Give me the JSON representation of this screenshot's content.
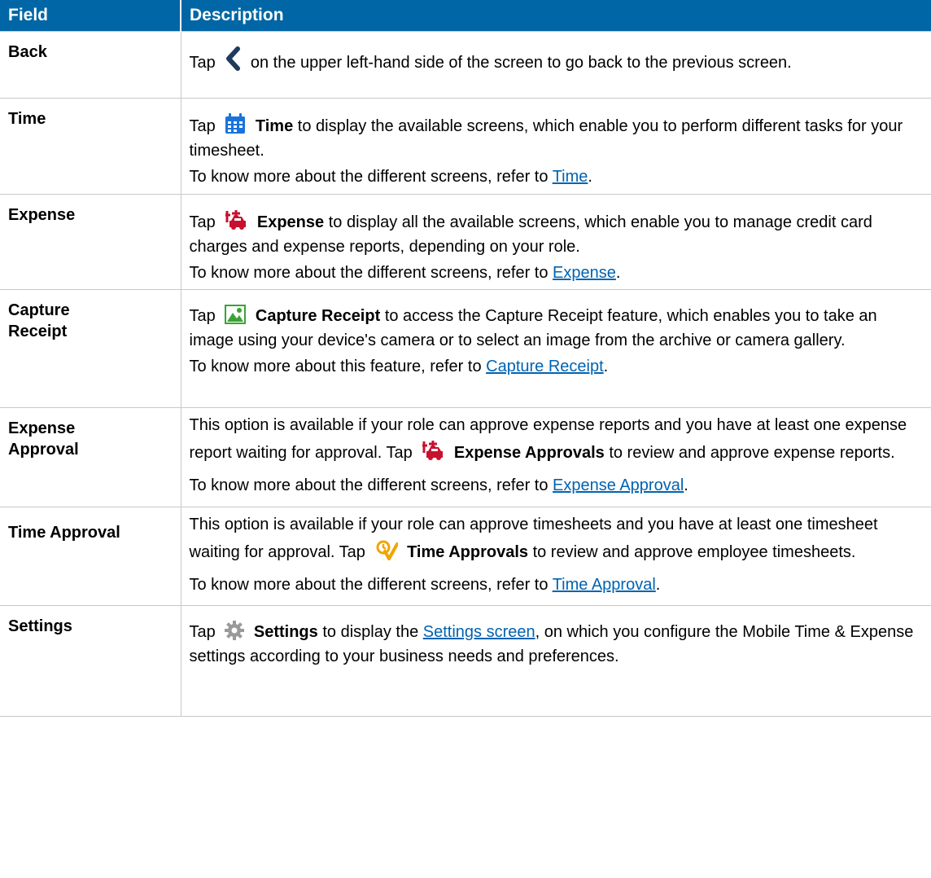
{
  "table": {
    "header_field": "Field",
    "header_description": "Description"
  },
  "rows": {
    "back": {
      "field": "Back",
      "d1_pre": "Tap",
      "d1_post": "on the upper left-hand side of the screen to go back to the previous screen.",
      "icon": "chevron-left-icon"
    },
    "time": {
      "field": "Time",
      "d1_pre": "Tap",
      "d1_bold": "Time",
      "d1_post": "to display the available screens, which enable you to perform different tasks for your timesheet.",
      "d2_pre": "To know more about the different screens, refer to",
      "d2_link": "Time",
      "d2_post": ".",
      "icon": "calendar-icon"
    },
    "expense": {
      "field": "Expense",
      "d1_pre": "Tap",
      "d1_bold": "Expense",
      "d1_post": "to display all the available screens, which enable you to manage credit card charges and expense reports, depending on your role.",
      "d2_pre": "To know more about the different screens, refer to",
      "d2_link": "Expense",
      "d2_post": ".",
      "icon": "travel-expense-icon"
    },
    "capture": {
      "field_l1": "Capture",
      "field_l2": "Receipt",
      "d1_pre": "Tap",
      "d1_bold": "Capture Receipt",
      "d1_post": "to access the Capture Receipt feature, which enables you to take an image using your device's camera or to select an image from the archive or camera gallery.",
      "d2_pre": "To know more about this feature, refer to",
      "d2_link": "Capture Receipt",
      "d2_post": ".",
      "icon": "image-icon"
    },
    "expense_approval": {
      "field_l1": "Expense",
      "field_l2": "Approval",
      "d1_pre": "This option is available if your role can approve expense reports and you have at least one expense report waiting for approval. Tap",
      "d1_bold": "Expense Approvals",
      "d1_post": "to review and approve expense reports.",
      "d2_pre": "To know more about the different screens, refer to",
      "d2_link": "Expense Approval",
      "d2_post": ".",
      "icon": "travel-expense-icon"
    },
    "time_approval": {
      "field": "Time Approval",
      "d1_pre": "This option is available if your role can approve timesheets and you have at least one timesheet waiting for approval. Tap",
      "d1_bold": "Time Approvals",
      "d1_post": "to review and approve employee timesheets.",
      "d2_pre": "To know more about the different screens, refer to",
      "d2_link": "Time Approval",
      "d2_post": ".",
      "icon": "time-approval-icon"
    },
    "settings": {
      "field": "Settings",
      "d1_pre": "Tap",
      "d1_bold": "Settings",
      "d1_mid": "to display the",
      "d1_link": "Settings screen",
      "d1_post": ", on which you configure the Mobile Time & Expense settings according to your business needs and preferences.",
      "icon": "gear-icon"
    }
  },
  "colors": {
    "header_bg": "#0066a6",
    "link": "#0063b1",
    "calendar": "#1a73d9",
    "expense": "#c8102e",
    "image": "#3aa335",
    "time_approval": "#f0a500",
    "gear": "#9a9a9a",
    "chevron": "#1f3a5f"
  }
}
